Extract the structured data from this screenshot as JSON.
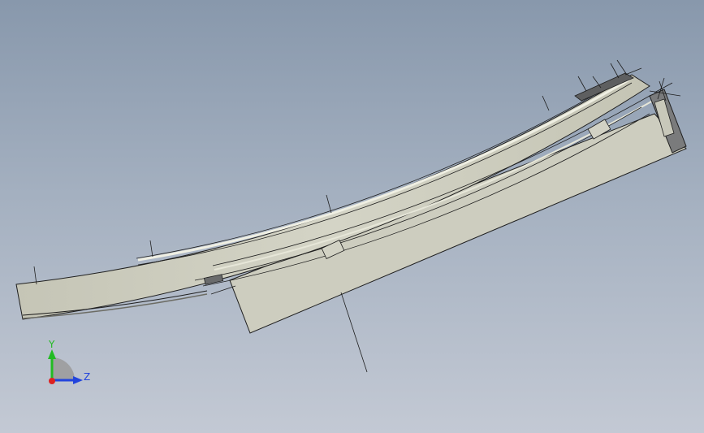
{
  "viewport": {
    "background_top": "#8898ac",
    "background_bottom": "#c3c9d4"
  },
  "part": {
    "body_color": "#ccccbe",
    "body_shade": "#b7b7a8",
    "edge_color": "#1e1e1e",
    "highlight_color": "#ececdf",
    "dark_detail_color": "#5e5f60"
  },
  "triad": {
    "y_label": "Y",
    "z_label": "Z",
    "y_color": "#22bb22",
    "z_color": "#2244dd",
    "x_color": "#dd2222",
    "arc_color": "#9a9a9a"
  }
}
